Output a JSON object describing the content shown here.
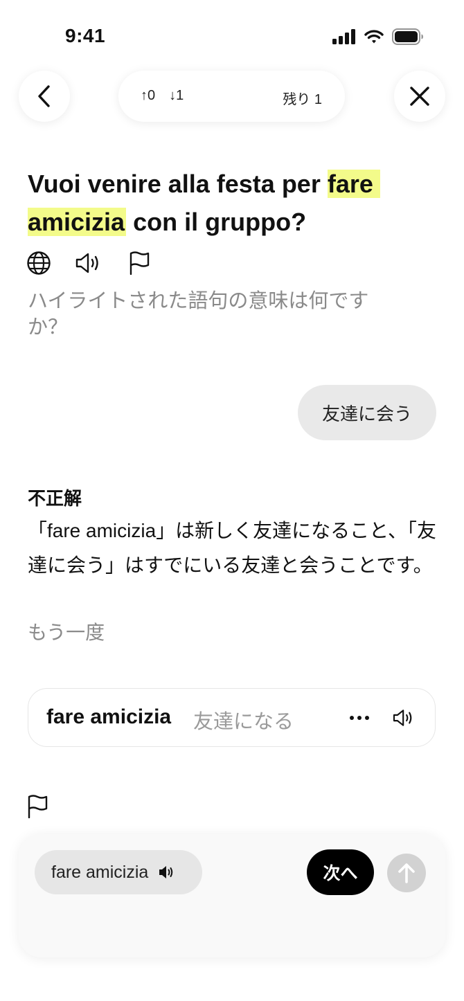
{
  "status_bar": {
    "time": "9:41"
  },
  "progress": {
    "up_count": "↑0",
    "down_count": "↓1",
    "remaining": "残り 1"
  },
  "question": {
    "before": "Vuoi venire alla festa per ",
    "highlight_1": "fare",
    "highlight_2": "amicizia",
    "after": " con il gruppo?",
    "highlight_color": "#f3fb8a"
  },
  "prompt": "ハイライトされた語句の意味は何ですか？",
  "answer": "友達に会う",
  "feedback": {
    "title": "不正解",
    "explanation": "「fare amicizia」は新しく友達になること、「友達に会う」はすでにいる友達と会うことです。",
    "retry": "もう一度"
  },
  "vocab": {
    "term": "fare amicizia",
    "meaning": "友達になる"
  },
  "bottom": {
    "chip_label": "fare amicizia",
    "next_label": "次へ"
  },
  "icons": {
    "back": "chevron-left-icon",
    "close": "close-icon",
    "translate": "globe-icon",
    "audio": "speaker-icon",
    "report": "flag-icon",
    "more": "more-icon",
    "send": "arrow-up-icon"
  }
}
